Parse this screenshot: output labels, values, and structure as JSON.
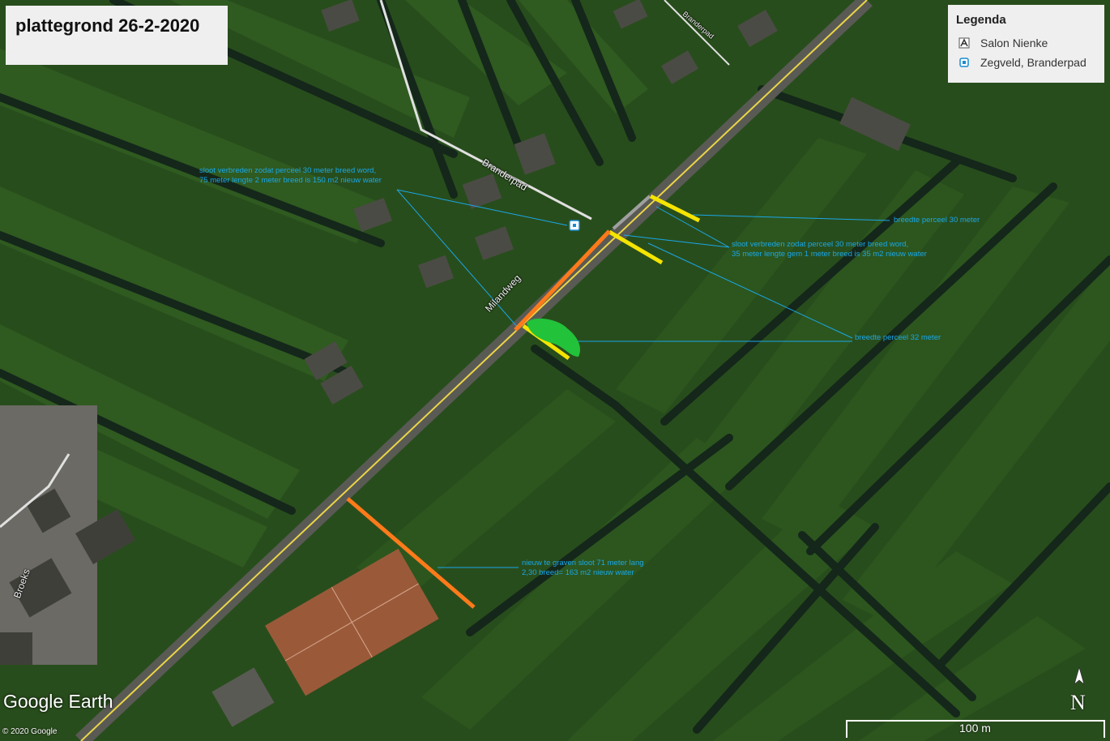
{
  "title": "plattegrond 26-2-2020",
  "legend": {
    "title": "Legenda",
    "items": [
      {
        "label": "Salon Nienke",
        "icon": "salon-icon"
      },
      {
        "label": "Zegveld, Branderpad",
        "icon": "place-pin-icon"
      }
    ]
  },
  "annotations": [
    {
      "id": "a1",
      "lines": [
        "sloot verbreden zodat perceel 30 meter breed word,",
        "75 meter lengte 2 meter breed is 150 m2 nieuw water"
      ]
    },
    {
      "id": "a2",
      "lines": [
        "breedte perceel 30 meter"
      ]
    },
    {
      "id": "a3",
      "lines": [
        "sloot verbreden zodat perceel 30 meter breed word,",
        "35 meter lengte gem 1 meter breed is 35 m2 nieuw water"
      ]
    },
    {
      "id": "a4",
      "lines": [
        "breedte perceel 32 meter"
      ]
    },
    {
      "id": "a5",
      "lines": [
        "nieuw te graven sloot 71 meter lang",
        "2,30 breed= 163 m2 nieuw water"
      ]
    }
  ],
  "road_labels": {
    "milandweg": "Milandweg",
    "branderpad": "Branderpad",
    "broeks": "Broeks",
    "top": "Branderpad"
  },
  "watermark": "Google Earth",
  "copyright": "© 2020 Google",
  "north_label": "N",
  "scale_label": "100 m",
  "colors": {
    "annotation": "#1aa7e8",
    "yellow_marker": "#f5e400",
    "orange_marker": "#ff7a1a",
    "green_area": "#22c23a"
  }
}
